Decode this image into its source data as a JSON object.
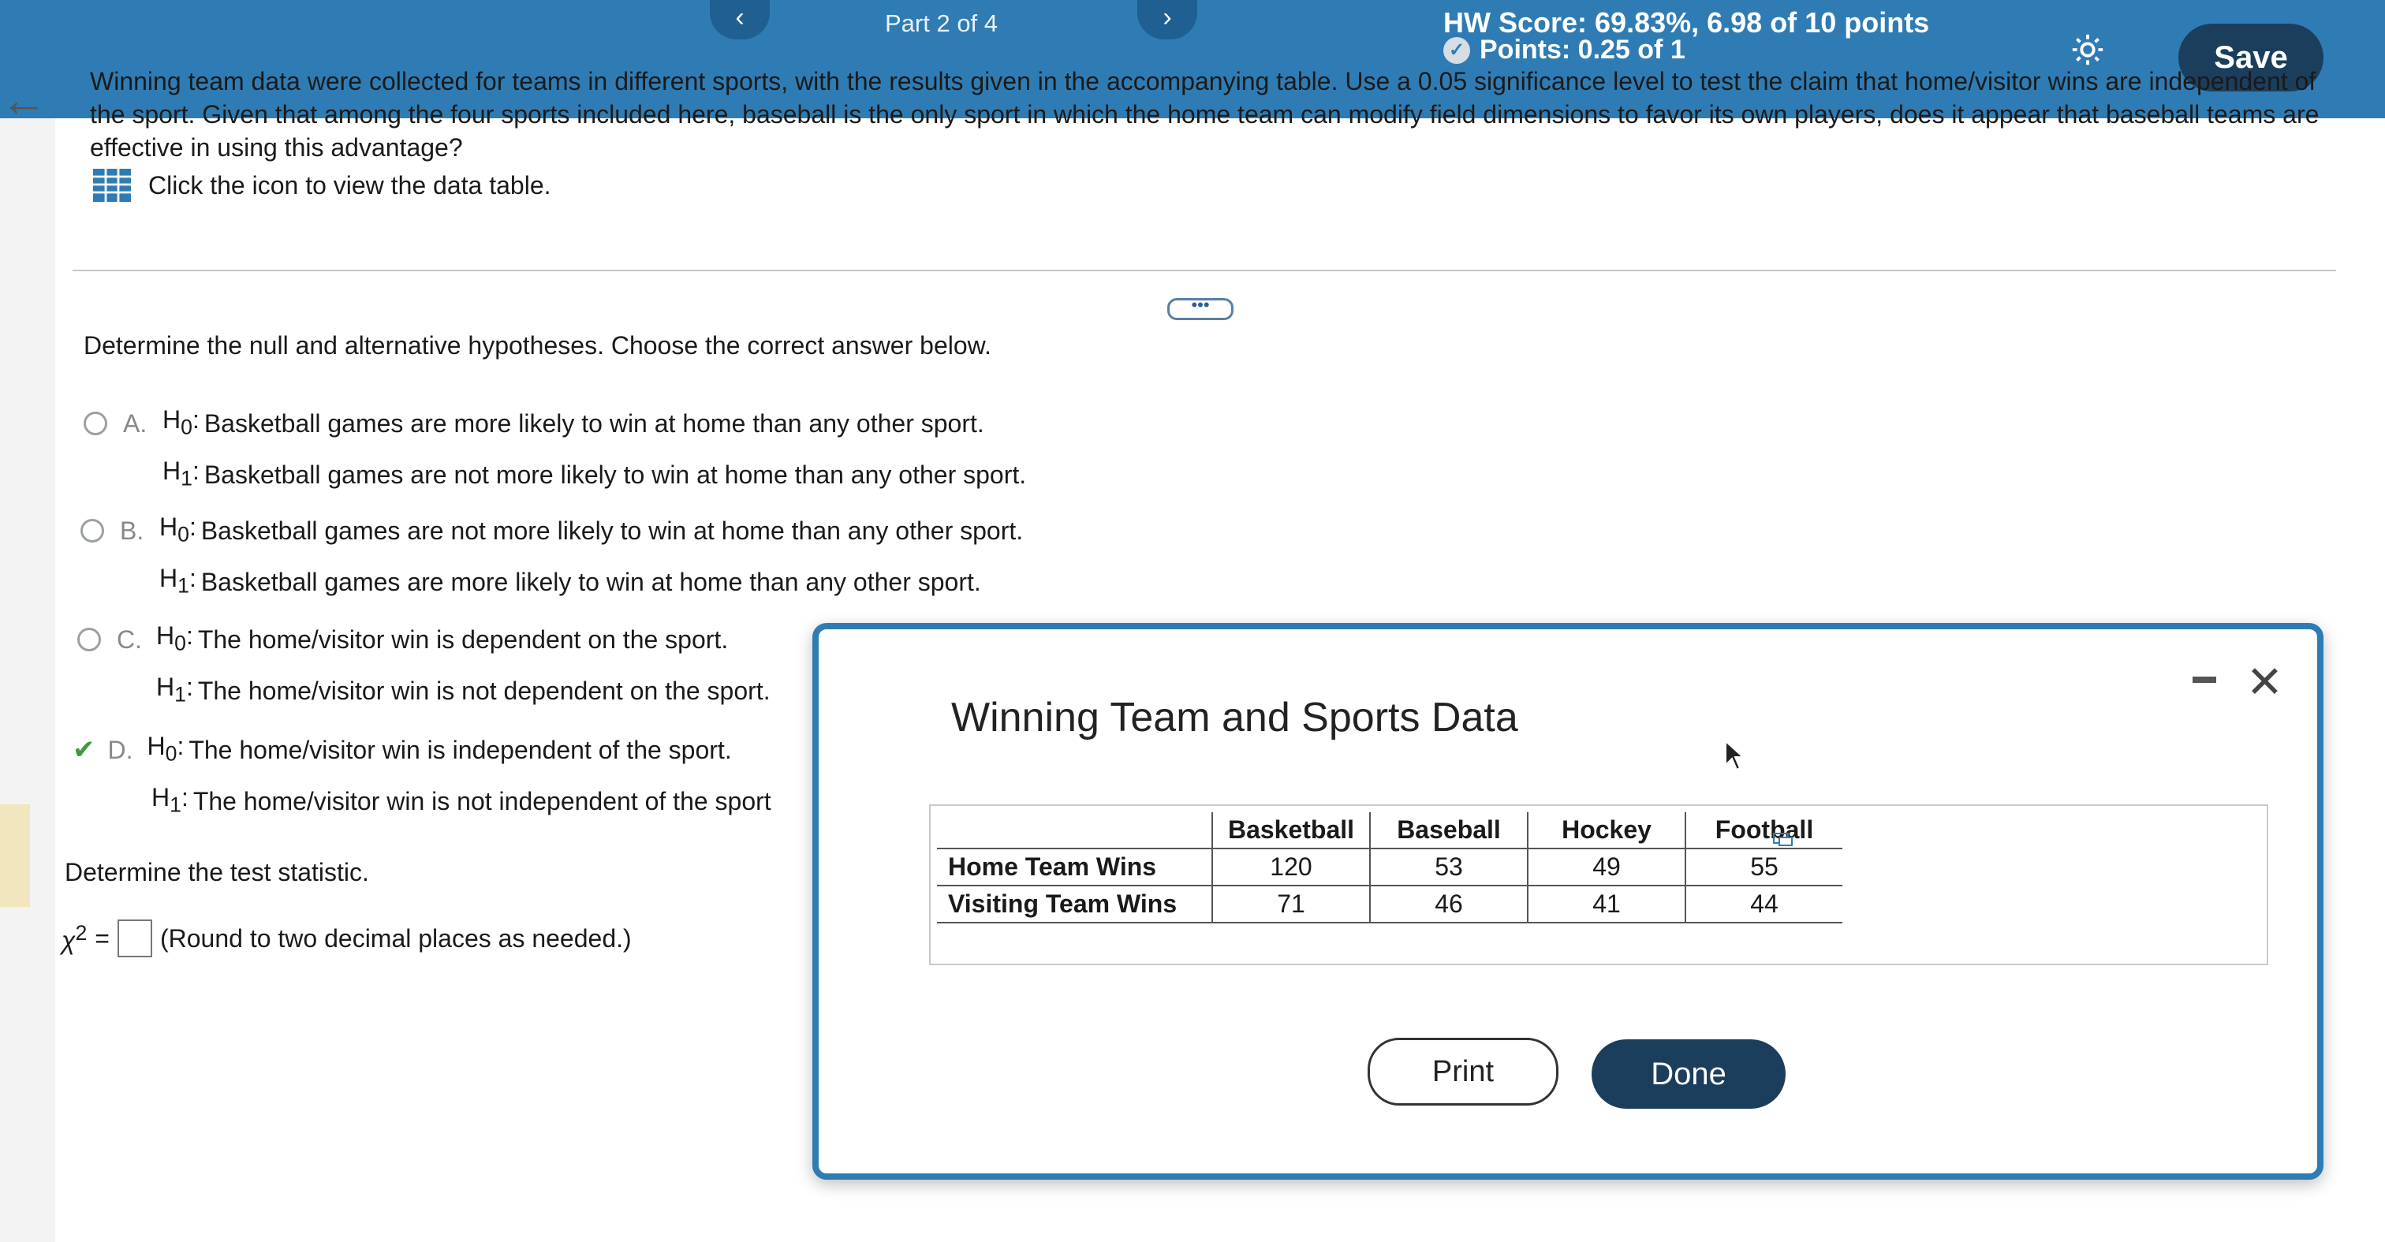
{
  "header": {
    "part": "Part 2 of 4",
    "prev_icon": "chevron-left-icon",
    "next_icon": "chevron-right-icon",
    "hw_score": "HW Score: 69.83%, 6.98 of 10 points",
    "points": "Points: 0.25 of 1",
    "save_label": "Save"
  },
  "question": {
    "text": "Winning team data were collected for teams in different sports, with the results given in the accompanying table. Use a 0.05 significance level to test the claim that home/visitor wins are independent of the sport. Given that among the four sports included here, baseball is the only sport in which the home team can modify field dimensions to favor its own players, does it appear that baseball teams are effective in using this advantage?",
    "table_link": "Click the icon to view the data table.",
    "ellipsis": "•••"
  },
  "hypotheses": {
    "prompt": "Determine the null and alternative hypotheses. Choose the correct answer below.",
    "options": [
      {
        "letter": "A.",
        "h0": "Basketball games are more likely to win at home than any other sport.",
        "h1": "Basketball games are not more likely to win at home than any other sport."
      },
      {
        "letter": "B.",
        "h0": "Basketball games are not more likely to win at home than any other sport.",
        "h1": "Basketball games are more likely to win at home than any other sport."
      },
      {
        "letter": "C.",
        "h0": "The home/visitor win is dependent on the sport.",
        "h1": "The home/visitor win is not dependent on the sport."
      },
      {
        "letter": "D.",
        "h0": "The home/visitor win is independent of the sport.",
        "h1": "The home/visitor win is not independent of the sport"
      }
    ],
    "h0_label": "H",
    "h0_sub": "0",
    "h1_label": "H",
    "h1_sub": "1",
    "selected": "D."
  },
  "statistic": {
    "prompt": "Determine the test statistic.",
    "symbol": "χ",
    "sup": "2",
    "equals": "=",
    "note": "(Round to two decimal places as needed.)"
  },
  "modal": {
    "title": "Winning Team and Sports Data",
    "columns": [
      "Basketball",
      "Baseball",
      "Hockey",
      "Football"
    ],
    "rows": [
      {
        "label": "Home Team Wins",
        "values": [
          "120",
          "53",
          "49",
          "55"
        ]
      },
      {
        "label": "Visiting Team Wins",
        "values": [
          "71",
          "46",
          "41",
          "44"
        ]
      }
    ],
    "print_label": "Print",
    "done_label": "Done"
  },
  "colors": {
    "header_bg": "#2f7cb4",
    "button_dark": "#1b3e5c",
    "check_green": "#3d9b3d"
  }
}
